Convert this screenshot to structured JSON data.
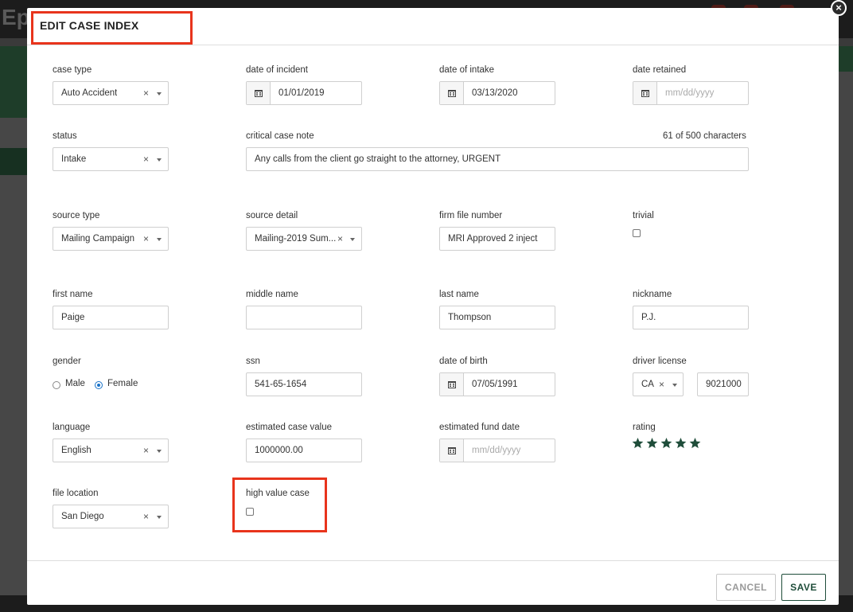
{
  "background": {
    "logo": "Ep"
  },
  "modal": {
    "title": "EDIT CASE INDEX",
    "close_glyph": "×"
  },
  "fields": {
    "case_type": {
      "label": "case type",
      "value": "Auto Accident"
    },
    "date_of_incident": {
      "label": "date of incident",
      "value": "01/01/2019"
    },
    "date_of_intake": {
      "label": "date of intake",
      "value": "03/13/2020"
    },
    "date_retained": {
      "label": "date retained",
      "placeholder": "mm/dd/yyyy"
    },
    "status": {
      "label": "status",
      "value": "Intake"
    },
    "critical_case_note": {
      "label": "critical case note",
      "counter": "61 of 500 characters",
      "value": "Any calls from the client go straight to the attorney, URGENT"
    },
    "source_type": {
      "label": "source type",
      "value": "Mailing Campaign"
    },
    "source_detail": {
      "label": "source detail",
      "value": "Mailing-2019 Sum..."
    },
    "firm_file_number": {
      "label": "firm file number",
      "value": "MRI Approved 2 inject"
    },
    "trivial": {
      "label": "trivial",
      "checked": false
    },
    "first_name": {
      "label": "first name",
      "value": "Paige"
    },
    "middle_name": {
      "label": "middle name",
      "value": ""
    },
    "last_name": {
      "label": "last name",
      "value": "Thompson"
    },
    "nickname": {
      "label": "nickname",
      "value": "P.J."
    },
    "gender": {
      "label": "gender",
      "options": [
        "Male",
        "Female"
      ],
      "selected": "Female"
    },
    "ssn": {
      "label": "ssn",
      "value": "541-65-1654"
    },
    "date_of_birth": {
      "label": "date of birth",
      "value": "07/05/1991"
    },
    "driver_license": {
      "label": "driver license",
      "state": "CA",
      "number": "9021000"
    },
    "language": {
      "label": "language",
      "value": "English"
    },
    "estimated_case_value": {
      "label": "estimated case value",
      "value": "1000000.00"
    },
    "estimated_fund_date": {
      "label": "estimated fund date",
      "placeholder": "mm/dd/yyyy"
    },
    "rating": {
      "label": "rating",
      "stars": 5,
      "max": 5
    },
    "file_location": {
      "label": "file location",
      "value": "San Diego"
    },
    "high_value_case": {
      "label": "high value case",
      "checked": false
    }
  },
  "footer": {
    "cancel_label": "CANCEL",
    "save_label": "SAVE"
  },
  "colors": {
    "highlight": "#e8341c",
    "brand_green": "#1f4d3a",
    "star": "#1f4d3a"
  },
  "icons": {
    "clear": "×",
    "calendar": "calendar-icon",
    "caret": "chevron-down-icon",
    "star": "star-icon"
  }
}
